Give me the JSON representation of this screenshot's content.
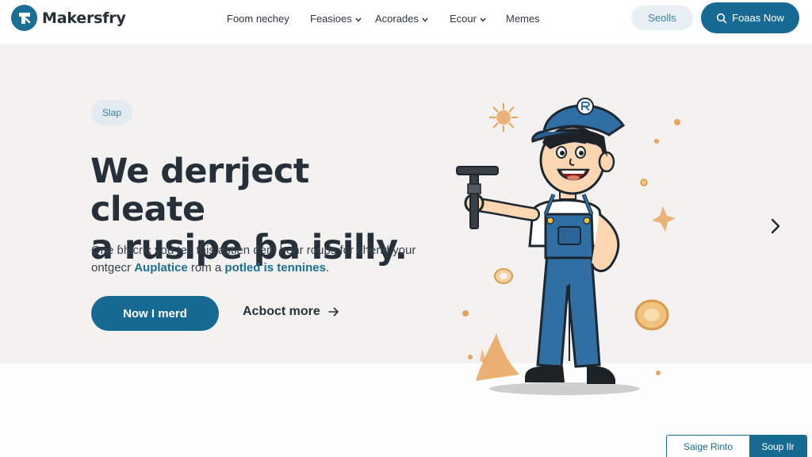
{
  "brand": {
    "name": "Makersfry",
    "color": "#176b92"
  },
  "nav": {
    "items": [
      {
        "label": "Foom nechey",
        "has_dropdown": false
      },
      {
        "label": "Feasioes",
        "has_dropdown": true
      },
      {
        "label": "Acorades",
        "has_dropdown": true
      },
      {
        "label": "Ecour",
        "has_dropdown": true
      },
      {
        "label": "Memes",
        "has_dropdown": false
      }
    ],
    "search_label": "Seolls",
    "cta_label": "Foaas Now",
    "cta_icon": "search-icon"
  },
  "hero": {
    "tag": "Slap",
    "headline_line1": "We derrject cleate",
    "headline_line2": "a rusipe ƥa isilly.",
    "sub_line1": "One ɓhicric you tec this astien dem henr roups for sherid your",
    "sub_line2_a": "ontgecr ",
    "sub_line2_link1": "Auplatice",
    "sub_line2_b": " rom a ",
    "sub_line2_link2": "potled is tennines",
    "sub_line2_c": ".",
    "primary_button": "Now I merd",
    "secondary_button": "Acboct more",
    "illustration": "plumber-with-wrench-illustration",
    "next_icon": "chevron-right-icon"
  },
  "bottom_widget": {
    "left_label": "Saige Rinto",
    "right_label": "Soup Ilr"
  }
}
